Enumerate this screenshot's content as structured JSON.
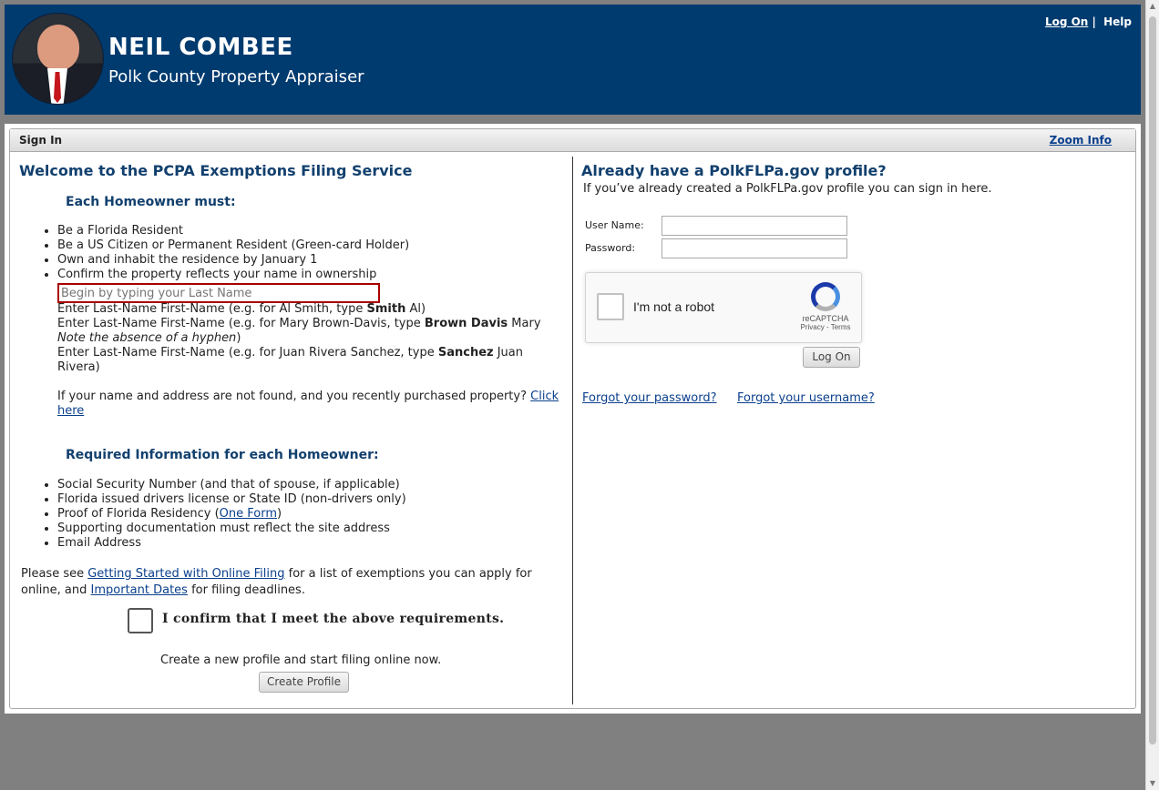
{
  "header": {
    "name": "NEIL COMBEE",
    "subtitle": "Polk County Property Appraiser",
    "logon_link": "Log On",
    "separator": "|",
    "help_link": "Help"
  },
  "panel": {
    "title": "Sign In",
    "zoom_link": "Zoom Info"
  },
  "left": {
    "heading": "Welcome to the PCPA Exemptions Filing Service",
    "homeowner_heading": "Each Homeowner must:",
    "requirements": [
      "Be a Florida Resident",
      "Be a US Citizen or Permanent Resident (Green-card Holder)",
      "Own and inhabit the residence by January 1",
      "Confirm the property reflects your name in ownership"
    ],
    "search_placeholder": "Begin by typing your Last Name",
    "hint1_pre": "Enter Last-Name First-Name (e.g. for Al Smith, type ",
    "hint1_bold": "Smith",
    "hint1_post": " Al)",
    "hint2_pre": "Enter Last-Name First-Name (e.g. for Mary Brown-Davis, type ",
    "hint2_bold": "Brown Davis",
    "hint2_post": " Mary",
    "hint2_note": "Note the absence of a hyphen",
    "hint2_close": ")",
    "hint3_pre": "Enter Last-Name First-Name (e.g. for Juan Rivera Sanchez, type ",
    "hint3_bold": "Sanchez",
    "hint3_post": " Juan Rivera)",
    "not_found_text": "If your name and address are not found, and you recently purchased property? ",
    "click_here_link": "Click here",
    "required_heading": "Required Information for each Homeowner:",
    "required_items": [
      "Social Security Number (and that of spouse, if applicable)",
      "Florida issued drivers license or State ID (non-drivers only)",
      "Supporting documentation must reflect the site address",
      "Email Address"
    ],
    "residency_pre": "Proof of Florida Residency (",
    "residency_link": "One Form",
    "residency_post": ")",
    "see_pre": "Please see ",
    "getting_started_link": "Getting Started with Online Filing",
    "see_mid": " for a list of exemptions you can apply for online, and ",
    "important_dates_link": "Important Dates",
    "see_post": " for filing deadlines.",
    "confirm_label": "I confirm that I meet the above requirements.",
    "create_text": "Create a new profile and start filing online now.",
    "create_button": "Create Profile"
  },
  "right": {
    "heading": "Already have a PolkFLPa.gov profile?",
    "intro": "If you’ve already created a PolkFLPa.gov profile you can sign in here.",
    "username_label": "User Name:",
    "password_label": "Password:",
    "recaptcha_label": "I'm not a robot",
    "recaptcha_brand": "reCAPTCHA",
    "recaptcha_terms": "Privacy - Terms",
    "logon_button": "Log On",
    "forgot_password": "Forgot your password?",
    "forgot_username": "Forgot your username?"
  }
}
